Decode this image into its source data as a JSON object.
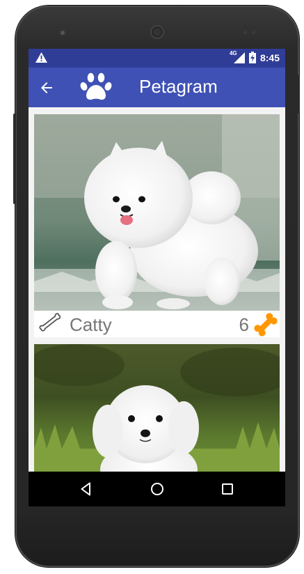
{
  "status_bar": {
    "warning_icon": "warning-icon",
    "network_label": "4G",
    "signal_icon": "signal-icon",
    "battery_icon": "battery-charging-icon",
    "time": "8:45"
  },
  "app_bar": {
    "back_icon": "arrow-back-icon",
    "logo_icon": "paw-icon",
    "title": "Petagram"
  },
  "pets": [
    {
      "name": "Catty",
      "likes": "6",
      "rate_icon": "bone-outline-icon",
      "likes_icon": "bone-filled-icon",
      "photo": "white pomeranian puppy"
    },
    {
      "photo": "white maltese puppy on grass"
    }
  ],
  "nav_bar": {
    "back_icon": "nav-back-triangle-icon",
    "home_icon": "nav-home-circle-icon",
    "recents_icon": "nav-recents-square-icon"
  },
  "colors": {
    "primary": "#3f51b5",
    "primary_dark": "#2f3d97",
    "accent": "#ff9800",
    "text_secondary": "#757575"
  }
}
